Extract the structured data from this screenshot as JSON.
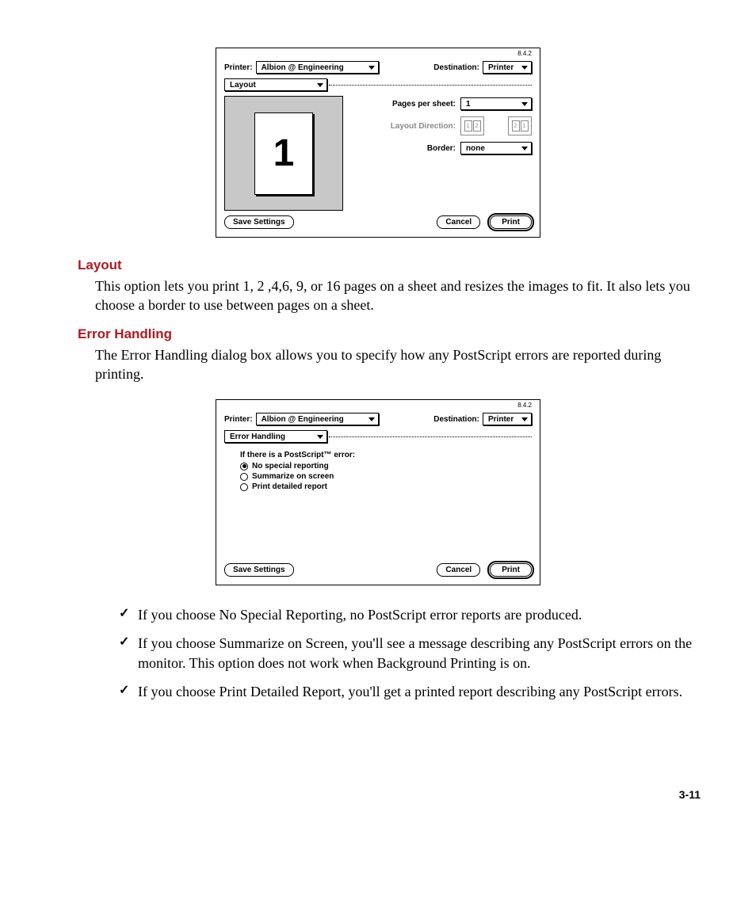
{
  "dialog1": {
    "version": "8.4.2",
    "printer_label": "Printer:",
    "printer_value": "Albion @ Engineering",
    "destination_label": "Destination:",
    "destination_value": "Printer",
    "panel_value": "Layout",
    "pages_per_sheet_label": "Pages per sheet:",
    "pages_per_sheet_value": "1",
    "layout_direction_label": "Layout Direction:",
    "layout_btn1_a": "1",
    "layout_btn1_b": "2",
    "layout_btn2_a": "2",
    "layout_btn2_b": "1",
    "border_label": "Border:",
    "border_value": "none",
    "preview_text": "1",
    "save_settings": "Save Settings",
    "cancel": "Cancel",
    "print": "Print"
  },
  "section_layout": {
    "heading": "Layout",
    "body": "This option lets you print 1, 2 ,4,6, 9, or 16 pages on a sheet and resizes the images to fit. It also lets you choose a border to use between pages on a sheet."
  },
  "section_error": {
    "heading": "Error Handling",
    "body": "The Error Handling dialog box allows you to specify how any PostScript errors are reported during printing."
  },
  "dialog2": {
    "version": "8.4.2",
    "printer_label": "Printer:",
    "printer_value": "Albion @ Engineering",
    "destination_label": "Destination:",
    "destination_value": "Printer",
    "panel_value": "Error Handling",
    "group_label": "If there is a PostScript™ error:",
    "opt1": "No special reporting",
    "opt2": "Summarize on screen",
    "opt3": "Print detailed report",
    "save_settings": "Save Settings",
    "cancel": "Cancel",
    "print": "Print"
  },
  "bullets": {
    "b1": "If you choose No Special Reporting, no PostScript error reports are produced.",
    "b2": "If you choose Summarize on Screen, you'll see a message describing any PostScript errors on the monitor. This option does not work when Background Printing is on.",
    "b3": "If you choose Print Detailed Report, you'll get a printed report describing any PostScript errors."
  },
  "page_number": "3-11"
}
